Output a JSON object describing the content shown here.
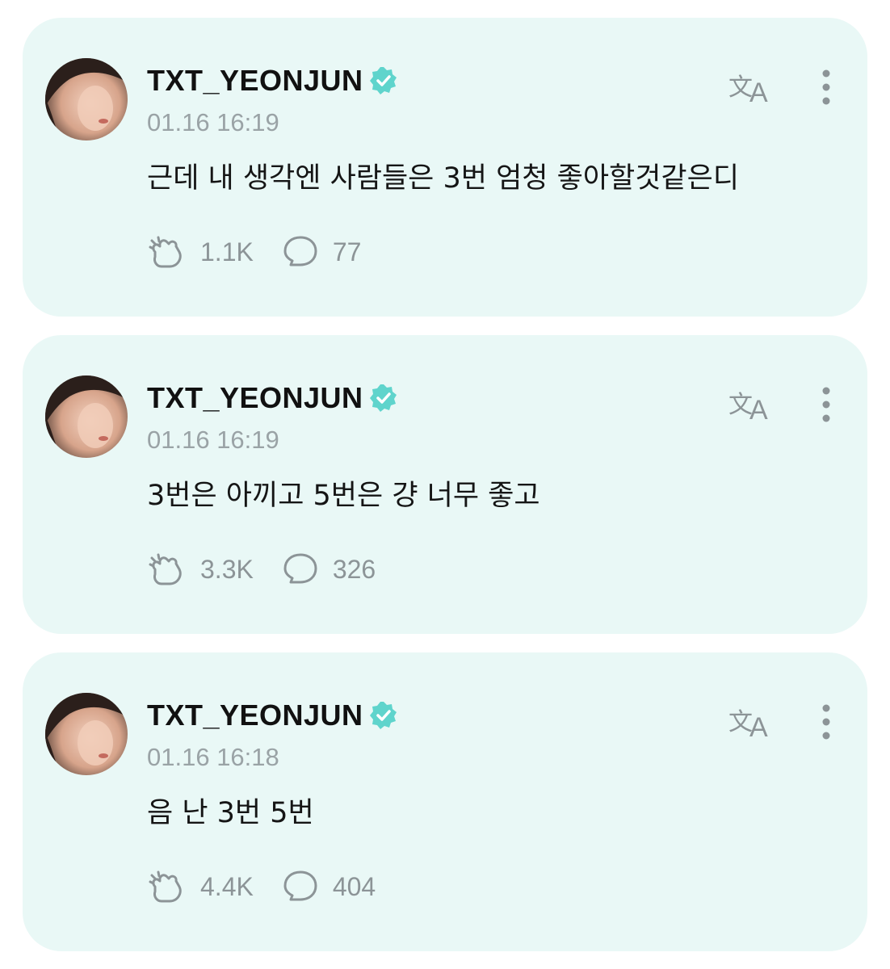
{
  "colors": {
    "card_bg": "#e9f8f6",
    "verified": "#5fd4cc",
    "muted": "#9aa3a6"
  },
  "posts": [
    {
      "username": "TXT_YEONJUN",
      "time": "01.16 16:19",
      "text": "근데 내 생각엔 사람들은 3번 엄청 좋아할것같은디",
      "likes": "1.1K",
      "comments": "77"
    },
    {
      "username": "TXT_YEONJUN",
      "time": "01.16 16:19",
      "text": "3번은 아끼고 5번은 걍 너무 좋고",
      "likes": "3.3K",
      "comments": "326"
    },
    {
      "username": "TXT_YEONJUN",
      "time": "01.16 16:18",
      "text": "음 난 3번 5번",
      "likes": "4.4K",
      "comments": "404"
    }
  ],
  "icons": {
    "verified": "verified-badge-icon",
    "translate": "translate-icon",
    "more": "more-vertical-icon",
    "like": "cheer-hand-icon",
    "comment": "comment-bubble-icon"
  }
}
